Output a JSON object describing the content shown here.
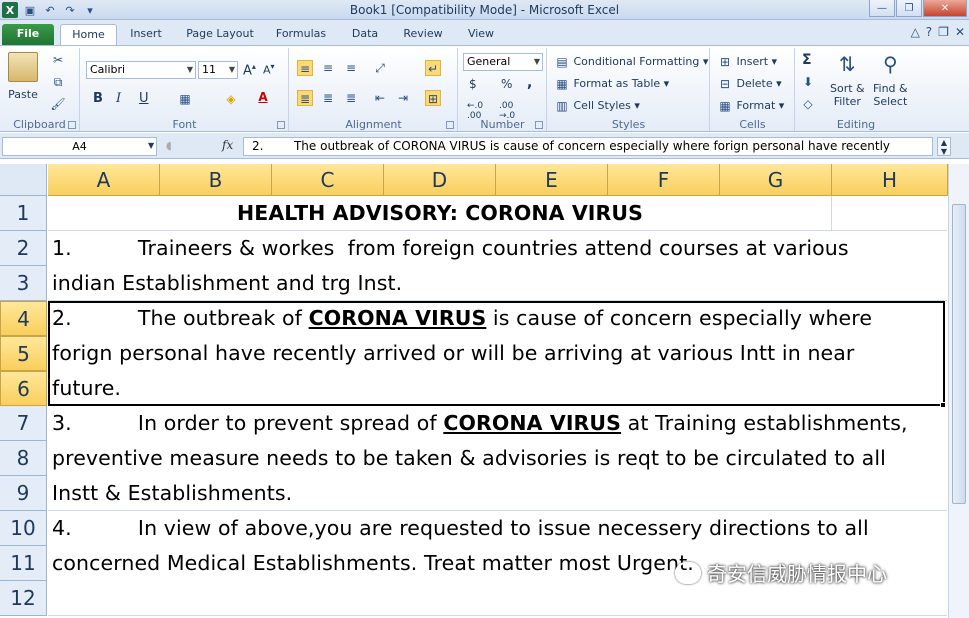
{
  "window": {
    "title": "Book1  [Compatibility Mode]  -  Microsoft Excel"
  },
  "tabs": [
    "File",
    "Home",
    "Insert",
    "Page Layout",
    "Formulas",
    "Data",
    "Review",
    "View"
  ],
  "ribbon": {
    "clipboard": {
      "label": "Clipboard",
      "paste": "Paste"
    },
    "font": {
      "label": "Font",
      "name": "Calibri",
      "size": "11",
      "bold": "B",
      "italic": "I",
      "underline": "U"
    },
    "alignment": {
      "label": "Alignment"
    },
    "number": {
      "label": "Number",
      "format": "General",
      "currency": "$",
      "percent": "%",
      "comma": ","
    },
    "styles": {
      "label": "Styles",
      "conditional": "Conditional Formatting",
      "table": "Format as Table",
      "cellstyles": "Cell Styles"
    },
    "cells": {
      "label": "Cells",
      "insert": "Insert",
      "delete": "Delete",
      "format": "Format"
    },
    "editing": {
      "label": "Editing",
      "sort1": "Sort &",
      "sort2": "Filter",
      "find1": "Find &",
      "find2": "Select",
      "sigma": "Σ"
    }
  },
  "formula": {
    "namebox": "A4",
    "fx": "fx",
    "content": "2.        The outbreak of CORONA VIRUS is cause of concern especially where forign personal have recently"
  },
  "columns": [
    "A",
    "B",
    "C",
    "D",
    "E",
    "F",
    "G",
    "H"
  ],
  "rows": [
    "1",
    "2",
    "3",
    "4",
    "5",
    "6",
    "7",
    "8",
    "9",
    "10",
    "11",
    "12"
  ],
  "cells": {
    "r1": "HEALTH ADVISORY: CORONA VIRUS",
    "r2": "1.          Traineers & workes  from foreign countries attend courses at various",
    "r3": "indian Establishment and trg Inst.",
    "r4a": "2.          The outbreak of ",
    "r4b": "CORONA VIRUS",
    "r4c": " is cause of concern especially where",
    "r5": "forign personal have recently arrived or will be arriving at various Intt in near",
    "r6": "future.",
    "r7a": "3.          In order to prevent spread of ",
    "r7b": "CORONA VIRUS",
    "r7c": " at Training establishments,",
    "r8": "preventive measure needs to be taken & advisories is reqt to be circulated to all",
    "r9": "Instt & Establishments.",
    "r10": "4.          In view of above,you are requested to issue necessery directions to all",
    "r11": "concerned Medical Establishments. Treat matter most Urgent."
  },
  "watermark": "奇安信威胁情报中心"
}
